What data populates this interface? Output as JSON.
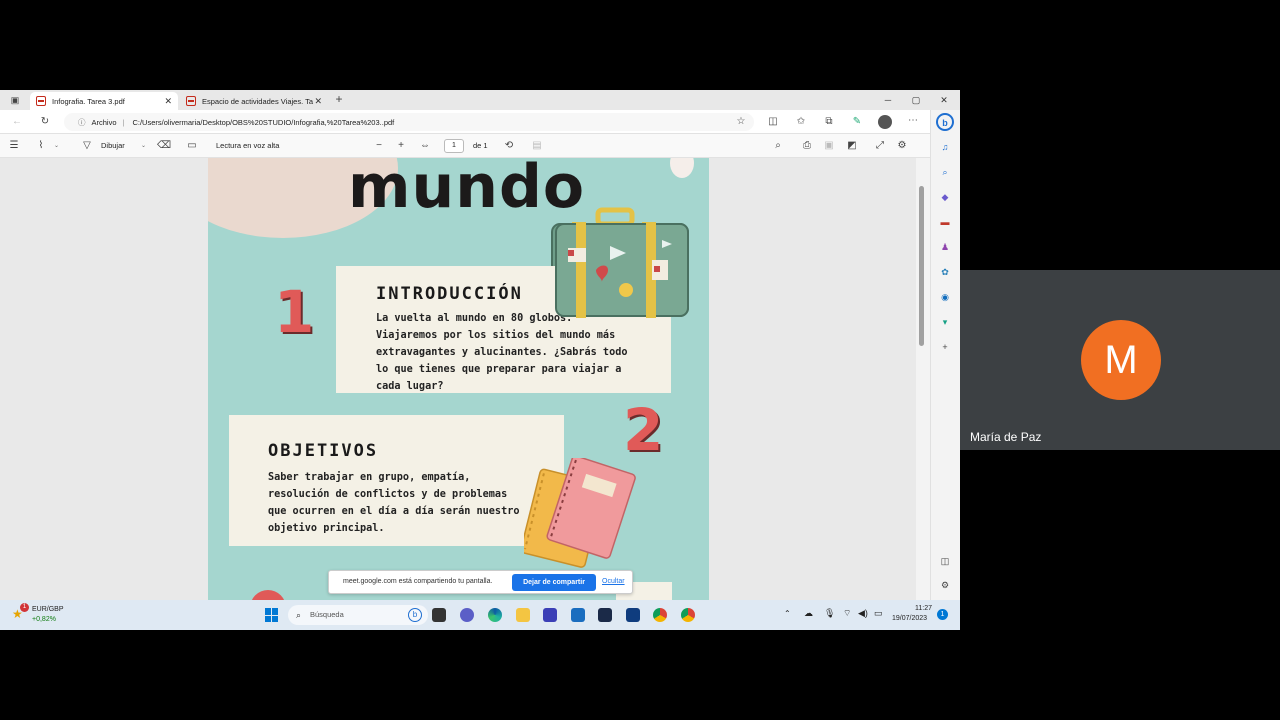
{
  "browser": {
    "tabs": [
      {
        "label": "Infografia. Tarea 3.pdf",
        "active": true
      },
      {
        "label": "Espacio de actividades Viajes. Ta",
        "active": false
      }
    ],
    "window_controls": {
      "minimize": "─",
      "maximize": "▢",
      "close": "✕"
    },
    "address": {
      "site_label": "Archivo",
      "url": "C:/Users/olivermaria/Desktop/OBS%20STUDIO/Infografia,%20Tarea%203..pdf"
    }
  },
  "pdf_toolbar": {
    "draw_label": "Dibujar",
    "read_aloud_label": "Lectura en voz alta",
    "page_current": "1",
    "page_total": "de 1"
  },
  "document": {
    "title": "mundo",
    "intro": {
      "number": "1",
      "heading": "INTRODUCCIÓN",
      "body": "La vuelta al mundo en 80 globos. Viajaremos por los sitios del mundo más extravagantes y alucinantes. ¿Sabrás todo lo que tienes que preparar para viajar a cada lugar?"
    },
    "objectives": {
      "number": "2",
      "heading": "OBJETIVOS",
      "body": "Saber trabajar en grupo, empatía, resolución de conflictos y de problemas que ocurren en el día a día serán nuestro objetivo principal."
    }
  },
  "share_notice": {
    "message": "meet.google.com está compartiendo tu pantalla.",
    "stop_label": "Dejar de compartir",
    "hide_label": "Ocultar"
  },
  "taskbar": {
    "ticker_name": "EUR/GBP",
    "ticker_change": "+0,82%",
    "ticker_badge": "1",
    "search_placeholder": "Búsqueda",
    "time": "11:27",
    "date": "19/07/2023",
    "notification_count": "1"
  },
  "meet": {
    "participant_initial": "M",
    "participant_name": "María de Paz"
  },
  "colors": {
    "page_bg": "#a5d6cf",
    "card_bg": "#f4f1e6",
    "number_red": "#e05a58",
    "avatar_orange": "#f16f22",
    "share_button": "#1a73e8"
  }
}
